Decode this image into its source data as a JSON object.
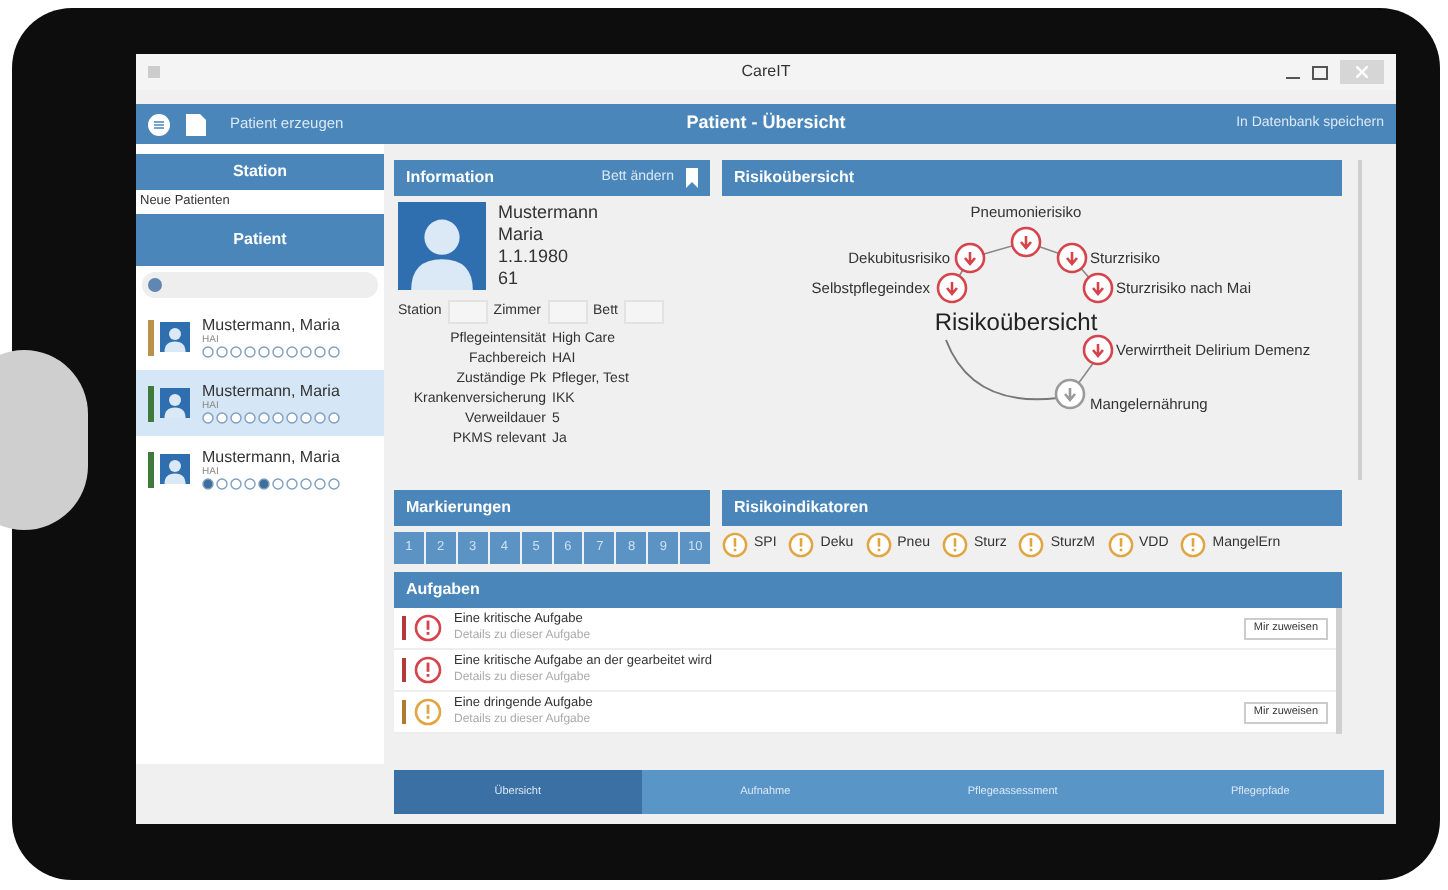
{
  "window": {
    "title": "CareIT"
  },
  "toolbar": {
    "create_label": "Patient erzeugen",
    "title": "Patient - Übersicht",
    "save_label": "In Datenbank speichern"
  },
  "sidebar": {
    "station_header": "Station",
    "station_value": "Neue Patienten",
    "patient_header": "Patient",
    "patients": [
      {
        "name": "Mustermann, Maria",
        "dept": "HAI",
        "color": "#b8924a",
        "selected": false,
        "dots": [
          false,
          false,
          false,
          false,
          false,
          false,
          false,
          false,
          false,
          false
        ]
      },
      {
        "name": "Mustermann, Maria",
        "dept": "HAI",
        "color": "#3f7a3a",
        "selected": true,
        "dots": [
          false,
          false,
          false,
          false,
          false,
          false,
          false,
          false,
          false,
          false
        ]
      },
      {
        "name": "Mustermann, Maria",
        "dept": "HAI",
        "color": "#3f7a3a",
        "selected": false,
        "dots": [
          true,
          false,
          false,
          false,
          true,
          false,
          false,
          false,
          false,
          false
        ]
      }
    ]
  },
  "information": {
    "title": "Information",
    "bed_action": "Bett ändern",
    "lines": [
      "Mustermann",
      "Maria",
      "1.1.1980",
      "61"
    ],
    "location_labels": [
      "Station",
      "Zimmer",
      "Bett"
    ],
    "fields": [
      {
        "label": "Pflegeintensität",
        "value": "High Care"
      },
      {
        "label": "Fachbereich",
        "value": "HAI"
      },
      {
        "label": "Zuständige Pk",
        "value": "Pfleger, Test"
      },
      {
        "label": "Krankenversicherung",
        "value": "IKK"
      },
      {
        "label": "Verweildauer",
        "value": "5"
      },
      {
        "label": "PKMS relevant",
        "value": "Ja"
      }
    ]
  },
  "risk_overview": {
    "title": "Risikoübersicht",
    "center_label": "Risikoübersicht",
    "risks": [
      {
        "name": "Pneumonierisiko",
        "kind": "critical"
      },
      {
        "name": "Dekubitusrisiko",
        "kind": "critical"
      },
      {
        "name": "Sturzrisiko",
        "kind": "critical"
      },
      {
        "name": "Selbstpflegeindex",
        "kind": "critical"
      },
      {
        "name": "Sturzrisiko nach Mai",
        "kind": "critical"
      },
      {
        "name": "Verwirrtheit Delirium Demenz",
        "kind": "critical"
      },
      {
        "name": "Mangelernährung",
        "kind": "neutral"
      }
    ]
  },
  "markings": {
    "title": "Markierungen",
    "numbers": [
      "1",
      "2",
      "3",
      "4",
      "5",
      "6",
      "7",
      "8",
      "9",
      "10"
    ]
  },
  "risk_indicators": {
    "title": "Risikoindikatoren",
    "items": [
      "SPI",
      "Deku",
      "Pneu",
      "Sturz",
      "SturzM",
      "VDD",
      "MangelErn"
    ]
  },
  "tasks": {
    "title": "Aufgaben",
    "items": [
      {
        "title": "Eine kritische Aufgabe",
        "details": "Details zu dieser Aufgabe",
        "kind": "critical",
        "action": "Mir zuweisen"
      },
      {
        "title": "Eine kritische Aufgabe an der gearbeitet wird",
        "details": "Details zu dieser Aufgabe",
        "kind": "critical"
      },
      {
        "title": "Eine dringende Aufgabe",
        "details": "Details zu dieser Aufgabe",
        "kind": "urgent",
        "action": "Mir zuweisen"
      }
    ]
  },
  "bottom_tabs": [
    {
      "label": "Übersicht",
      "selected": true
    },
    {
      "label": "Aufnahme",
      "selected": false
    },
    {
      "label": "Pflegeassessment",
      "selected": false
    },
    {
      "label": "Pflegepfade",
      "selected": false
    }
  ]
}
